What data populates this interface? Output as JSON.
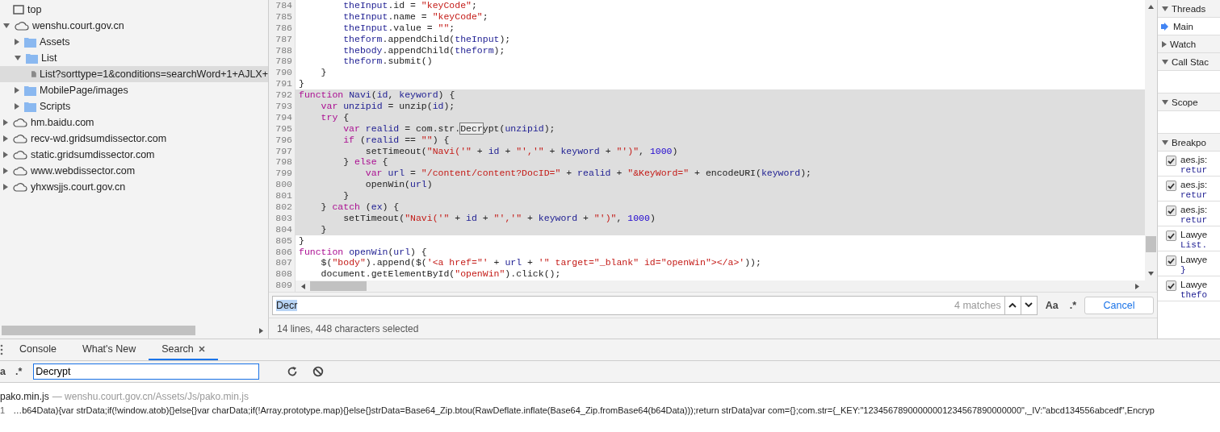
{
  "navigator": {
    "items": [
      {
        "label": "top",
        "kind": "frame",
        "selected": false
      },
      {
        "label": "wenshu.court.gov.cn",
        "kind": "domain",
        "expanded": true,
        "selected": false,
        "children": [
          {
            "label": "Assets",
            "kind": "folder",
            "expanded": false,
            "selected": false
          },
          {
            "label": "List",
            "kind": "folder",
            "expanded": true,
            "selected": false,
            "children": [
              {
                "label": "List?sorttype=1&conditions=searchWord+1+AJLX+",
                "kind": "file",
                "selected": true
              }
            ]
          },
          {
            "label": "MobilePage/images",
            "kind": "folder",
            "expanded": false,
            "selected": false
          },
          {
            "label": "Scripts",
            "kind": "folder",
            "expanded": false,
            "selected": false
          }
        ]
      },
      {
        "label": "hm.baidu.com",
        "kind": "domain",
        "expanded": false,
        "selected": false
      },
      {
        "label": "recv-wd.gridsumdissector.com",
        "kind": "domain",
        "expanded": false,
        "selected": false
      },
      {
        "label": "static.gridsumdissector.com",
        "kind": "domain",
        "expanded": false,
        "selected": false
      },
      {
        "label": "www.webdissector.com",
        "kind": "domain",
        "expanded": false,
        "selected": false
      },
      {
        "label": "yhxwsjjs.court.gov.cn",
        "kind": "domain",
        "expanded": false,
        "selected": false
      }
    ]
  },
  "editor": {
    "lines": [
      {
        "n": "784",
        "selected": false,
        "tokens": [
          {
            "kind": "variable",
            "text": "        theInput"
          },
          {
            "kind": "plain",
            "text": ".id = "
          },
          {
            "kind": "string",
            "text": "\"keyCode\""
          },
          {
            "kind": "plain",
            "text": ";"
          }
        ]
      },
      {
        "n": "785",
        "selected": false,
        "tokens": [
          {
            "kind": "variable",
            "text": "        theInput"
          },
          {
            "kind": "plain",
            "text": ".name = "
          },
          {
            "kind": "string",
            "text": "\"keyCode\""
          },
          {
            "kind": "plain",
            "text": ";"
          }
        ]
      },
      {
        "n": "786",
        "selected": false,
        "tokens": [
          {
            "kind": "variable",
            "text": "        theInput"
          },
          {
            "kind": "plain",
            "text": ".value = "
          },
          {
            "kind": "string",
            "text": "\"\""
          },
          {
            "kind": "plain",
            "text": ";"
          }
        ]
      },
      {
        "n": "787",
        "selected": false,
        "tokens": [
          {
            "kind": "variable",
            "text": "        theform"
          },
          {
            "kind": "plain",
            "text": ".appendChild("
          },
          {
            "kind": "variable",
            "text": "theInput"
          },
          {
            "kind": "plain",
            "text": ");"
          }
        ]
      },
      {
        "n": "788",
        "selected": false,
        "tokens": [
          {
            "kind": "variable",
            "text": "        thebody"
          },
          {
            "kind": "plain",
            "text": ".appendChild("
          },
          {
            "kind": "variable",
            "text": "theform"
          },
          {
            "kind": "plain",
            "text": ");"
          }
        ]
      },
      {
        "n": "789",
        "selected": false,
        "tokens": [
          {
            "kind": "variable",
            "text": "        theform"
          },
          {
            "kind": "plain",
            "text": ".submit()"
          }
        ]
      },
      {
        "n": "790",
        "selected": false,
        "tokens": [
          {
            "kind": "plain",
            "text": "    }"
          }
        ]
      },
      {
        "n": "791",
        "selected": false,
        "tokens": [
          {
            "kind": "plain",
            "text": "}"
          }
        ]
      },
      {
        "n": "792",
        "selected": true,
        "tokens": [
          {
            "kind": "keyword",
            "text": "function "
          },
          {
            "kind": "variable",
            "text": "Navi"
          },
          {
            "kind": "plain",
            "text": "("
          },
          {
            "kind": "variable",
            "text": "id"
          },
          {
            "kind": "plain",
            "text": ", "
          },
          {
            "kind": "variable",
            "text": "keyword"
          },
          {
            "kind": "plain",
            "text": ") {"
          }
        ]
      },
      {
        "n": "793",
        "selected": true,
        "tokens": [
          {
            "kind": "keyword",
            "text": "    var "
          },
          {
            "kind": "variable",
            "text": "unzipid"
          },
          {
            "kind": "plain",
            "text": " = unzip("
          },
          {
            "kind": "variable",
            "text": "id"
          },
          {
            "kind": "plain",
            "text": ");"
          }
        ]
      },
      {
        "n": "794",
        "selected": true,
        "tokens": [
          {
            "kind": "keyword",
            "text": "    try"
          },
          {
            "kind": "plain",
            "text": " {"
          }
        ]
      },
      {
        "n": "795",
        "selected": true,
        "tokens": [
          {
            "kind": "keyword",
            "text": "        var "
          },
          {
            "kind": "variable",
            "text": "realid"
          },
          {
            "kind": "plain",
            "text": " = com.str."
          },
          {
            "kind": "match",
            "text": "Decr"
          },
          {
            "kind": "plain",
            "text": "ypt("
          },
          {
            "kind": "variable",
            "text": "unzipid"
          },
          {
            "kind": "plain",
            "text": ");"
          }
        ]
      },
      {
        "n": "796",
        "selected": true,
        "tokens": [
          {
            "kind": "keyword",
            "text": "        if"
          },
          {
            "kind": "plain",
            "text": " ("
          },
          {
            "kind": "variable",
            "text": "realid"
          },
          {
            "kind": "plain",
            "text": " == "
          },
          {
            "kind": "string",
            "text": "\"\""
          },
          {
            "kind": "plain",
            "text": ") {"
          }
        ]
      },
      {
        "n": "797",
        "selected": true,
        "tokens": [
          {
            "kind": "plain",
            "text": "            setTimeout("
          },
          {
            "kind": "string",
            "text": "\"Navi('\""
          },
          {
            "kind": "plain",
            "text": " + "
          },
          {
            "kind": "variable",
            "text": "id"
          },
          {
            "kind": "plain",
            "text": " + "
          },
          {
            "kind": "string",
            "text": "\"','\""
          },
          {
            "kind": "plain",
            "text": " + "
          },
          {
            "kind": "variable",
            "text": "keyword"
          },
          {
            "kind": "plain",
            "text": " + "
          },
          {
            "kind": "string",
            "text": "\"')\""
          },
          {
            "kind": "plain",
            "text": ", "
          },
          {
            "kind": "number",
            "text": "1000"
          },
          {
            "kind": "plain",
            "text": ")"
          }
        ]
      },
      {
        "n": "798",
        "selected": true,
        "tokens": [
          {
            "kind": "plain",
            "text": "        } "
          },
          {
            "kind": "keyword",
            "text": "else"
          },
          {
            "kind": "plain",
            "text": " {"
          }
        ]
      },
      {
        "n": "799",
        "selected": true,
        "tokens": [
          {
            "kind": "keyword",
            "text": "            var "
          },
          {
            "kind": "variable",
            "text": "url"
          },
          {
            "kind": "plain",
            "text": " = "
          },
          {
            "kind": "string",
            "text": "\"/content/content?DocID=\""
          },
          {
            "kind": "plain",
            "text": " + "
          },
          {
            "kind": "variable",
            "text": "realid"
          },
          {
            "kind": "plain",
            "text": " + "
          },
          {
            "kind": "string",
            "text": "\"&KeyWord=\""
          },
          {
            "kind": "plain",
            "text": " + encodeURI("
          },
          {
            "kind": "variable",
            "text": "keyword"
          },
          {
            "kind": "plain",
            "text": ");"
          }
        ]
      },
      {
        "n": "800",
        "selected": true,
        "tokens": [
          {
            "kind": "plain",
            "text": "            openWin("
          },
          {
            "kind": "variable",
            "text": "url"
          },
          {
            "kind": "plain",
            "text": ")"
          }
        ]
      },
      {
        "n": "801",
        "selected": true,
        "tokens": [
          {
            "kind": "plain",
            "text": "        }"
          }
        ]
      },
      {
        "n": "802",
        "selected": true,
        "tokens": [
          {
            "kind": "plain",
            "text": "    } "
          },
          {
            "kind": "keyword",
            "text": "catch"
          },
          {
            "kind": "plain",
            "text": " ("
          },
          {
            "kind": "variable",
            "text": "ex"
          },
          {
            "kind": "plain",
            "text": ") {"
          }
        ]
      },
      {
        "n": "803",
        "selected": true,
        "tokens": [
          {
            "kind": "plain",
            "text": "        setTimeout("
          },
          {
            "kind": "string",
            "text": "\"Navi('\""
          },
          {
            "kind": "plain",
            "text": " + "
          },
          {
            "kind": "variable",
            "text": "id"
          },
          {
            "kind": "plain",
            "text": " + "
          },
          {
            "kind": "string",
            "text": "\"','\""
          },
          {
            "kind": "plain",
            "text": " + "
          },
          {
            "kind": "variable",
            "text": "keyword"
          },
          {
            "kind": "plain",
            "text": " + "
          },
          {
            "kind": "string",
            "text": "\"')\""
          },
          {
            "kind": "plain",
            "text": ", "
          },
          {
            "kind": "number",
            "text": "1000"
          },
          {
            "kind": "plain",
            "text": ")"
          }
        ]
      },
      {
        "n": "804",
        "selected": true,
        "tokens": [
          {
            "kind": "plain",
            "text": "    }"
          }
        ]
      },
      {
        "n": "805",
        "selected": false,
        "tokens": [
          {
            "kind": "plain",
            "text": "}"
          }
        ]
      },
      {
        "n": "806",
        "selected": false,
        "tokens": [
          {
            "kind": "keyword",
            "text": "function "
          },
          {
            "kind": "variable",
            "text": "openWin"
          },
          {
            "kind": "plain",
            "text": "("
          },
          {
            "kind": "variable",
            "text": "url"
          },
          {
            "kind": "plain",
            "text": ") {"
          }
        ]
      },
      {
        "n": "807",
        "selected": false,
        "tokens": [
          {
            "kind": "plain",
            "text": "    $("
          },
          {
            "kind": "string",
            "text": "\"body\""
          },
          {
            "kind": "plain",
            "text": ").append($("
          },
          {
            "kind": "string",
            "text": "'<a href=\"'"
          },
          {
            "kind": "plain",
            "text": " + "
          },
          {
            "kind": "variable",
            "text": "url"
          },
          {
            "kind": "plain",
            "text": " + "
          },
          {
            "kind": "string",
            "text": "'\" target=\"_blank\" id=\"openWin\"></a>'"
          },
          {
            "kind": "plain",
            "text": "));"
          }
        ]
      },
      {
        "n": "808",
        "selected": false,
        "tokens": [
          {
            "kind": "plain",
            "text": "    document.getElementById("
          },
          {
            "kind": "string",
            "text": "\"openWin\""
          },
          {
            "kind": "plain",
            "text": ").click();"
          }
        ]
      },
      {
        "n": "809",
        "selected": false
      }
    ],
    "find": {
      "value": "Decr",
      "count": "4 matches",
      "case_label": "Aa",
      "regex_label": ".*",
      "cancel": "Cancel"
    },
    "status": "14 lines, 448 characters selected"
  },
  "sidebar": {
    "sections": [
      {
        "title": "Threads",
        "expanded": true,
        "kind": "threads",
        "items": [
          {
            "label": "Main"
          }
        ]
      },
      {
        "title": "Watch",
        "expanded": false
      },
      {
        "title": "Call Stac",
        "expanded": true,
        "kind": "empty"
      },
      {
        "title": "Scope",
        "expanded": true,
        "kind": "empty"
      },
      {
        "title": "Breakpo",
        "expanded": true,
        "kind": "breakpoints",
        "items": [
          {
            "file": "aes.js:",
            "code": "retur",
            "checked": true
          },
          {
            "file": "aes.js:",
            "code": "retur",
            "checked": true
          },
          {
            "file": "aes.js:",
            "code": "retur",
            "checked": true
          },
          {
            "file": "Lawye",
            "code": "List.",
            "checked": true
          },
          {
            "file": "Lawye",
            "code": "}",
            "checked": true
          },
          {
            "file": "Lawye",
            "code": "thefo",
            "checked": true
          }
        ]
      }
    ]
  },
  "drawer": {
    "tabs": [
      {
        "label": "Console",
        "selected": false,
        "closable": false
      },
      {
        "label": "What's New",
        "selected": false,
        "closable": false
      },
      {
        "label": "Search",
        "selected": true,
        "closable": true
      }
    ],
    "search": {
      "case_label": "a",
      "regex_label": ".*",
      "value": "Decrypt"
    },
    "results": [
      {
        "file": "pako.min.js",
        "path": "— wenshu.court.gov.cn/Assets/Js/pako.min.js",
        "matches": [
          {
            "line": "1",
            "text": "…b64Data){var strData;if(!window.atob){}else{}var charData;if(!Array.prototype.map){}else{}strData=Base64_Zip.btou(RawDeflate.inflate(Base64_Zip.fromBase64(b64Data)));return strData}var com={};com.str={_KEY:\"12345678900000001234567890000000\",_IV:\"abcd134556abcedf\",Encryp"
          }
        ]
      }
    ]
  }
}
